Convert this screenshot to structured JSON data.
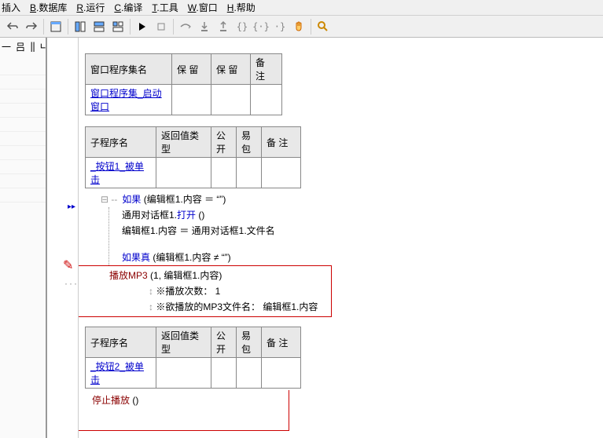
{
  "menu": {
    "insert": "插入",
    "database": "B.数据库",
    "run": "R.运行",
    "compile": "C.编译",
    "tools": "T.工具",
    "window": "W.窗口",
    "help": "H.帮助"
  },
  "left_tabs": {
    "t1": "一",
    "t2": "吕",
    "t3": "咄",
    "t4": "匕"
  },
  "table1": {
    "h1": "窗口程序集名",
    "h2": "保  留",
    "h3": "保  留",
    "h4": "备  注",
    "v1": "窗口程序集_启动窗口"
  },
  "table2": {
    "h1": "子程序名",
    "h2": "返回值类型",
    "h3": "公开",
    "h4": "易包",
    "h5": "备  注",
    "v1": "_按钮1_被单击"
  },
  "code1": {
    "if": "如果",
    "cond": " (编辑框1.内容 ＝ “”)",
    "l1a": "通用对话框1.",
    "l1b": "打开",
    "l1c": " ()",
    "l2a": "编辑框1.内容 ＝ 通用对话框1.文件名",
    "iftrue": "如果真",
    "cond2": " (编辑框1.内容 ≠ “”)",
    "l3a": "播放MP3",
    "l3b": " (1, 编辑框1.内容)",
    "l4": "※播放次数： 1",
    "l5": "※欲播放的MP3文件名： 编辑框1.内容"
  },
  "table3": {
    "h1": "子程序名",
    "h2": "返回值类型",
    "h3": "公开",
    "h4": "易包",
    "h5": "备  注",
    "v1": "_按钮2_被单击"
  },
  "code2": {
    "l1a": "停止播放",
    "l1b": " ()"
  }
}
